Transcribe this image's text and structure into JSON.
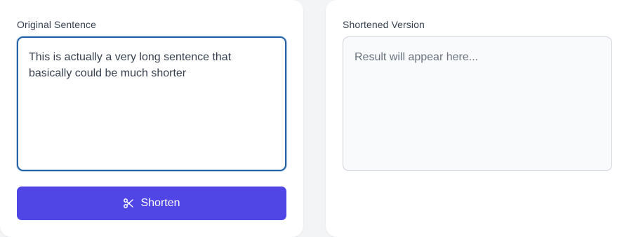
{
  "original": {
    "label": "Original Sentence",
    "value": "This is actually a very long sentence that basically could be much shorter"
  },
  "action": {
    "button_label": "Shorten",
    "icon": "scissors-icon",
    "color": "#4f46e5"
  },
  "result": {
    "label": "Shortened Version",
    "placeholder": "Result will appear here..."
  },
  "colors": {
    "focus_border": "#2563a8",
    "background": "#f3f4f6",
    "card": "#ffffff",
    "output_bg": "#f8fafc"
  }
}
